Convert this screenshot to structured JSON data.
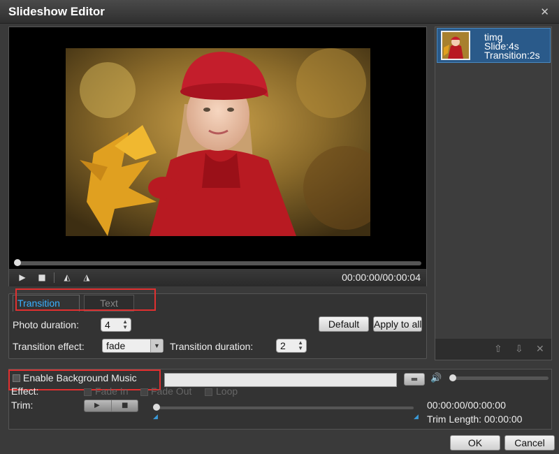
{
  "window": {
    "title": "Slideshow Editor",
    "close_glyph": "✕"
  },
  "preview": {
    "timecode": "00:00:00/00:00:04",
    "controls": {
      "play": "▶",
      "stop": "■",
      "prev": "◭",
      "next": "◮"
    }
  },
  "tabs": [
    {
      "label": "Transition",
      "active": true
    },
    {
      "label": "Text",
      "active": false
    }
  ],
  "transition": {
    "photo_duration_label": "Photo duration:",
    "photo_duration_value": "4",
    "default_button": "Default",
    "apply_button": "Apply to all",
    "transition_effect_label": "Transition effect:",
    "transition_effect_value": "fade",
    "transition_duration_label": "Transition duration:",
    "transition_duration_value": "2"
  },
  "slides": [
    {
      "name": "timg",
      "slide": "Slide:4s",
      "transition": "Transition:2s"
    }
  ],
  "sidebar_icons": {
    "up": "⇧",
    "down": "⇩",
    "delete": "✕"
  },
  "music": {
    "enable_label": "Enable Background Music",
    "file_value": "",
    "volume_icon": "🔊",
    "volume_level": 0.0,
    "effect_label": "Effect:",
    "fade_in_label": "Fade In",
    "fade_out_label": "Fade Out",
    "loop_label": "Loop",
    "trim_label": "Trim:",
    "trim_time": "00:00:00/00:00:00",
    "trim_length": "Trim Length: 00:00:00"
  },
  "footer": {
    "ok": "OK",
    "cancel": "Cancel"
  }
}
